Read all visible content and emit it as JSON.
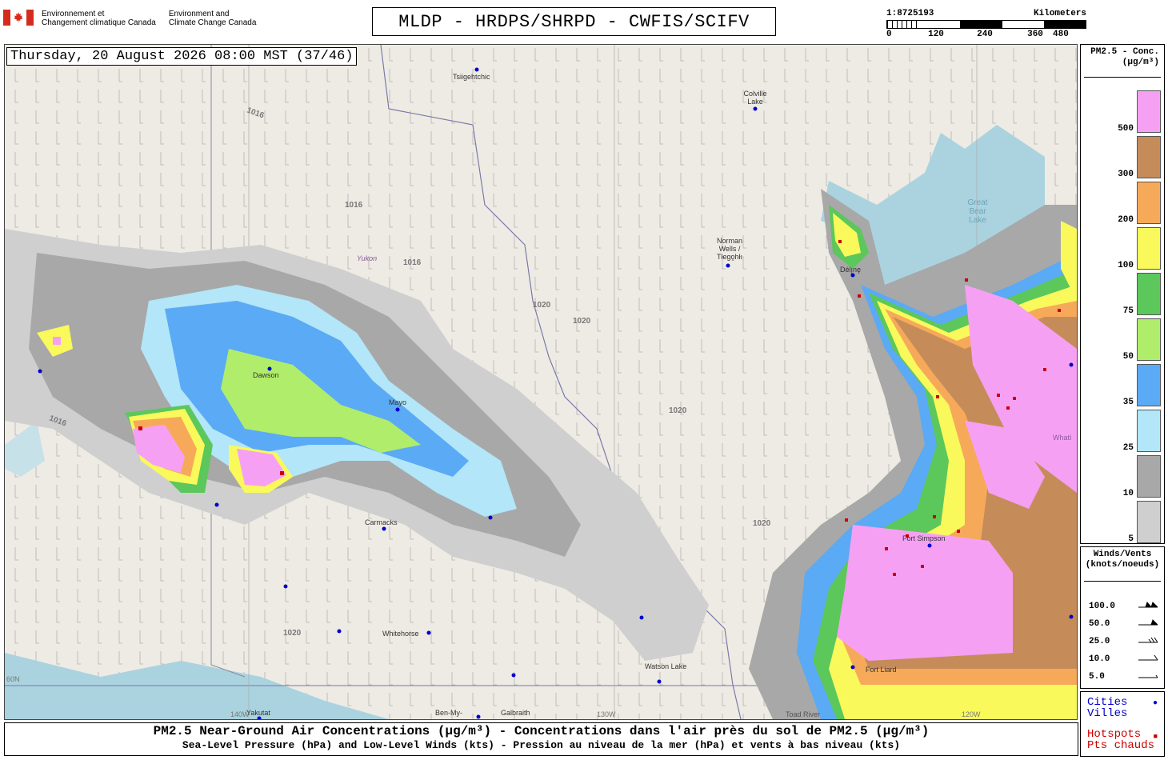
{
  "header": {
    "department_fr": [
      "Environnement et",
      "Changement climatique Canada"
    ],
    "department_en": [
      "Environment and",
      "Climate Change Canada"
    ],
    "title": "MLDP - HRDPS/SHRPD - CWFIS/SCIFV",
    "scale": {
      "ratio": "1:8725193",
      "unit": "Kilometers",
      "ticks": [
        "0",
        "120",
        "240",
        "360",
        "480"
      ]
    }
  },
  "map": {
    "timestamp": "Thursday, 20 August 2026 08:00 MST (37/46)",
    "place_labels": [
      "Tsiigehtchic",
      "Colville Lake",
      "Norman Wells / Tłegǫhłı",
      "Délı̨nę",
      "Great Bear Lake",
      "Yukon",
      "Dawson",
      "Mayo",
      "Carmacks",
      "Whitehorse",
      "Watson Lake",
      "Fort Simpson",
      "Fort Liard",
      "Yakutat",
      "Ben-My-",
      "Galbraith",
      "Toad River",
      "Whatì",
      "130W",
      "120W",
      "140W",
      "60N"
    ],
    "isobar_labels": [
      "1016",
      "1020"
    ],
    "colors": {
      "land": "#eeebe4",
      "water": "#aad3df",
      "border": "#8a8ab0",
      "city_dot": "#0000cc",
      "hotspot": "#cc0000"
    }
  },
  "legend": {
    "pm_title": [
      "PM2.5 - Conc.",
      "(µg/m³)"
    ],
    "pm_levels": [
      {
        "label": "500",
        "color": "#f6a0f4"
      },
      {
        "label": "300",
        "color": "#c58c5a"
      },
      {
        "label": "200",
        "color": "#f7a95a"
      },
      {
        "label": "100",
        "color": "#f9f95c"
      },
      {
        "label": "75",
        "color": "#5cc75a"
      },
      {
        "label": "50",
        "color": "#b0ed6a"
      },
      {
        "label": "35",
        "color": "#5aaaf5"
      },
      {
        "label": "25",
        "color": "#b2e6f8"
      },
      {
        "label": "10",
        "color": "#a8a8a8"
      },
      {
        "label": "5",
        "color": "#cfcfcf"
      }
    ],
    "wind_title": [
      "Winds/Vents",
      "(knots/noeuds)"
    ],
    "wind_levels": [
      "100.0",
      "50.0",
      "25.0",
      "10.0",
      "5.0"
    ],
    "cities": [
      "Cities",
      "Villes"
    ],
    "hotspots": [
      "Hotspots",
      "Pts chauds"
    ]
  },
  "footer": {
    "line1": "PM2.5 Near-Ground Air Concentrations (µg/m³) - Concentrations dans l'air près du sol de PM2.5 (µg/m³)",
    "line2": "Sea-Level Pressure (hPa) and Low-Level Winds (kts) - Pression au niveau de la mer (hPa) et vents à bas niveau (kts)"
  }
}
